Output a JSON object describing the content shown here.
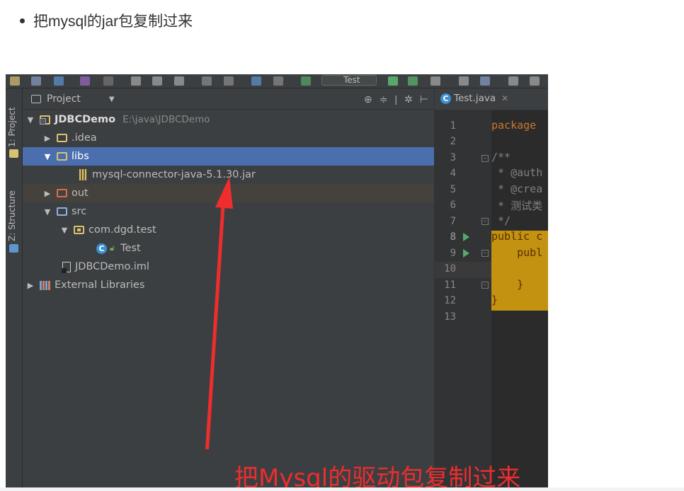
{
  "instruction": "把mysql的jar包复制过来",
  "toolbar": {
    "run_config": "Test"
  },
  "side_tabs": {
    "project": "1: Project",
    "structure": "Z: Structure"
  },
  "project_panel": {
    "title": "Project"
  },
  "tree": [
    {
      "id": "root",
      "label": "JDBCDemo",
      "path": "E:\\java\\JDBCDemo"
    },
    {
      "id": "idea",
      "label": ".idea"
    },
    {
      "id": "libs",
      "label": "libs"
    },
    {
      "id": "jar",
      "label": "mysql-connector-java-5.1.30.jar"
    },
    {
      "id": "out",
      "label": "out"
    },
    {
      "id": "src",
      "label": "src"
    },
    {
      "id": "pkg",
      "label": "com.dgd.test"
    },
    {
      "id": "test",
      "label": "Test"
    },
    {
      "id": "iml",
      "label": "JDBCDemo.iml"
    },
    {
      "id": "extlib",
      "label": "External Libraries"
    }
  ],
  "editor": {
    "tab": "Test.java",
    "line_numbers": [
      "1",
      "2",
      "3",
      "4",
      "5",
      "6",
      "7",
      "8",
      "9",
      "10",
      "11",
      "12",
      "13"
    ],
    "code": {
      "l1": "package",
      "l3": "/**",
      "l4": " * @auth",
      "l5": " * @crea",
      "l6": " * 测试类",
      "l7": " */",
      "l8": "public c",
      "l9": "    publ",
      "l11": "    }",
      "l12": "}"
    }
  },
  "annotation": "把Mysql的驱动包复制过来",
  "colors": {
    "selection": "#4b6eaf",
    "annotation": "#ee2d2d",
    "highlight": "#c39211"
  }
}
